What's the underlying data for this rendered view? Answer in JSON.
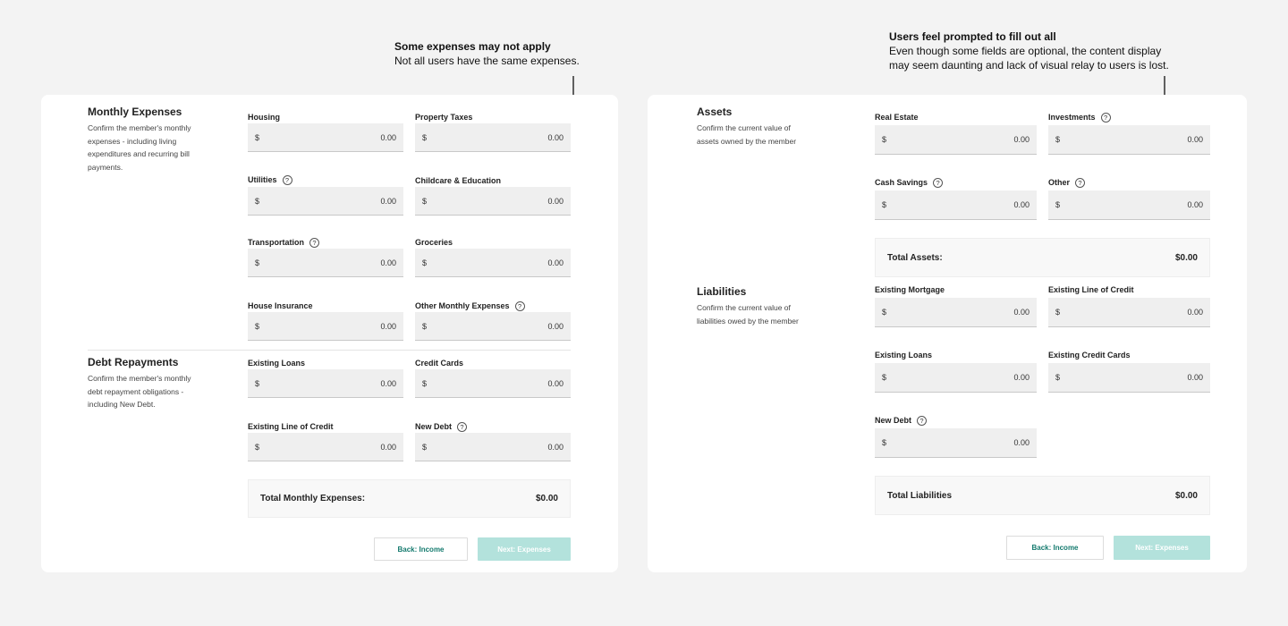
{
  "annotations": {
    "left": {
      "title": "Some expenses may not apply",
      "body": "Not all users have the same expenses."
    },
    "right": {
      "title": "Users feel prompted to fill out all",
      "body_line1": "Even though some fields are optional, the content display",
      "body_line2": "may seem daunting and lack of visual relay to users is lost."
    }
  },
  "expenses": {
    "monthly": {
      "title": "Monthly Expenses",
      "desc": [
        "Confirm the member's monthly",
        "expenses - including living",
        "expenditures and recurring bill",
        "payments."
      ],
      "fields": [
        {
          "label": "Housing",
          "help": false,
          "currency": "$",
          "value": "0.00"
        },
        {
          "label": "Property Taxes",
          "help": false,
          "currency": "$",
          "value": "0.00"
        },
        {
          "label": "Utilities",
          "help": true,
          "currency": "$",
          "value": "0.00"
        },
        {
          "label": "Childcare & Education",
          "help": false,
          "currency": "$",
          "value": "0.00"
        },
        {
          "label": "Transportation",
          "help": true,
          "currency": "$",
          "value": "0.00"
        },
        {
          "label": "Groceries",
          "help": false,
          "currency": "$",
          "value": "0.00"
        },
        {
          "label": "House Insurance",
          "help": false,
          "currency": "$",
          "value": "0.00"
        },
        {
          "label": "Other Monthly Expenses",
          "help": true,
          "currency": "$",
          "value": "0.00"
        }
      ]
    },
    "debt": {
      "title": "Debt Repayments",
      "desc": [
        "Confirm the member's monthly",
        "debt repayment obligations -",
        "including New Debt."
      ],
      "fields": [
        {
          "label": "Existing Loans",
          "help": false,
          "currency": "$",
          "value": "0.00"
        },
        {
          "label": "Credit Cards",
          "help": false,
          "currency": "$",
          "value": "0.00"
        },
        {
          "label": "Existing Line of Credit",
          "help": false,
          "currency": "$",
          "value": "0.00"
        },
        {
          "label": "New Debt",
          "help": true,
          "currency": "$",
          "value": "0.00"
        }
      ]
    },
    "total": {
      "label": "Total Monthly Expenses:",
      "value": "$0.00"
    },
    "back_label": "Back: Income",
    "next_label": "Next: Expenses"
  },
  "networth": {
    "assets": {
      "title": "Assets",
      "desc": [
        "Confirm the current value of",
        "assets owned by the member"
      ],
      "fields": [
        {
          "label": "Real Estate",
          "help": false,
          "currency": "$",
          "value": "0.00"
        },
        {
          "label": "Investments",
          "help": true,
          "currency": "$",
          "value": "0.00"
        },
        {
          "label": "Cash Savings",
          "help": true,
          "currency": "$",
          "value": "0.00"
        },
        {
          "label": "Other",
          "help": true,
          "currency": "$",
          "value": "0.00"
        }
      ],
      "total": {
        "label": "Total Assets:",
        "value": "$0.00"
      }
    },
    "liabilities": {
      "title": "Liabilities",
      "desc": [
        "Confirm the current value of",
        "liabilities owed by the member"
      ],
      "fields": [
        {
          "label": "Existing Mortgage",
          "help": false,
          "currency": "$",
          "value": "0.00"
        },
        {
          "label": "Existing Line of Credit",
          "help": false,
          "currency": "$",
          "value": "0.00"
        },
        {
          "label": "Existing Loans",
          "help": false,
          "currency": "$",
          "value": "0.00"
        },
        {
          "label": "Existing Credit Cards",
          "help": false,
          "currency": "$",
          "value": "0.00"
        },
        {
          "label": "New Debt",
          "help": true,
          "currency": "$",
          "value": "0.00"
        }
      ],
      "total": {
        "label": "Total Liabilities",
        "value": "$0.00"
      }
    },
    "back_label": "Back: Income",
    "next_label": "Next: Expenses"
  },
  "help_glyph": "?",
  "colors": {
    "page_bg": "#f3f3f3",
    "accent": "#147a6e",
    "next_disabled": "#b3e2dc",
    "field_bg": "#efefef"
  },
  "icons": {
    "arrow": "arrow-down-icon",
    "help": "help-circle-icon"
  }
}
